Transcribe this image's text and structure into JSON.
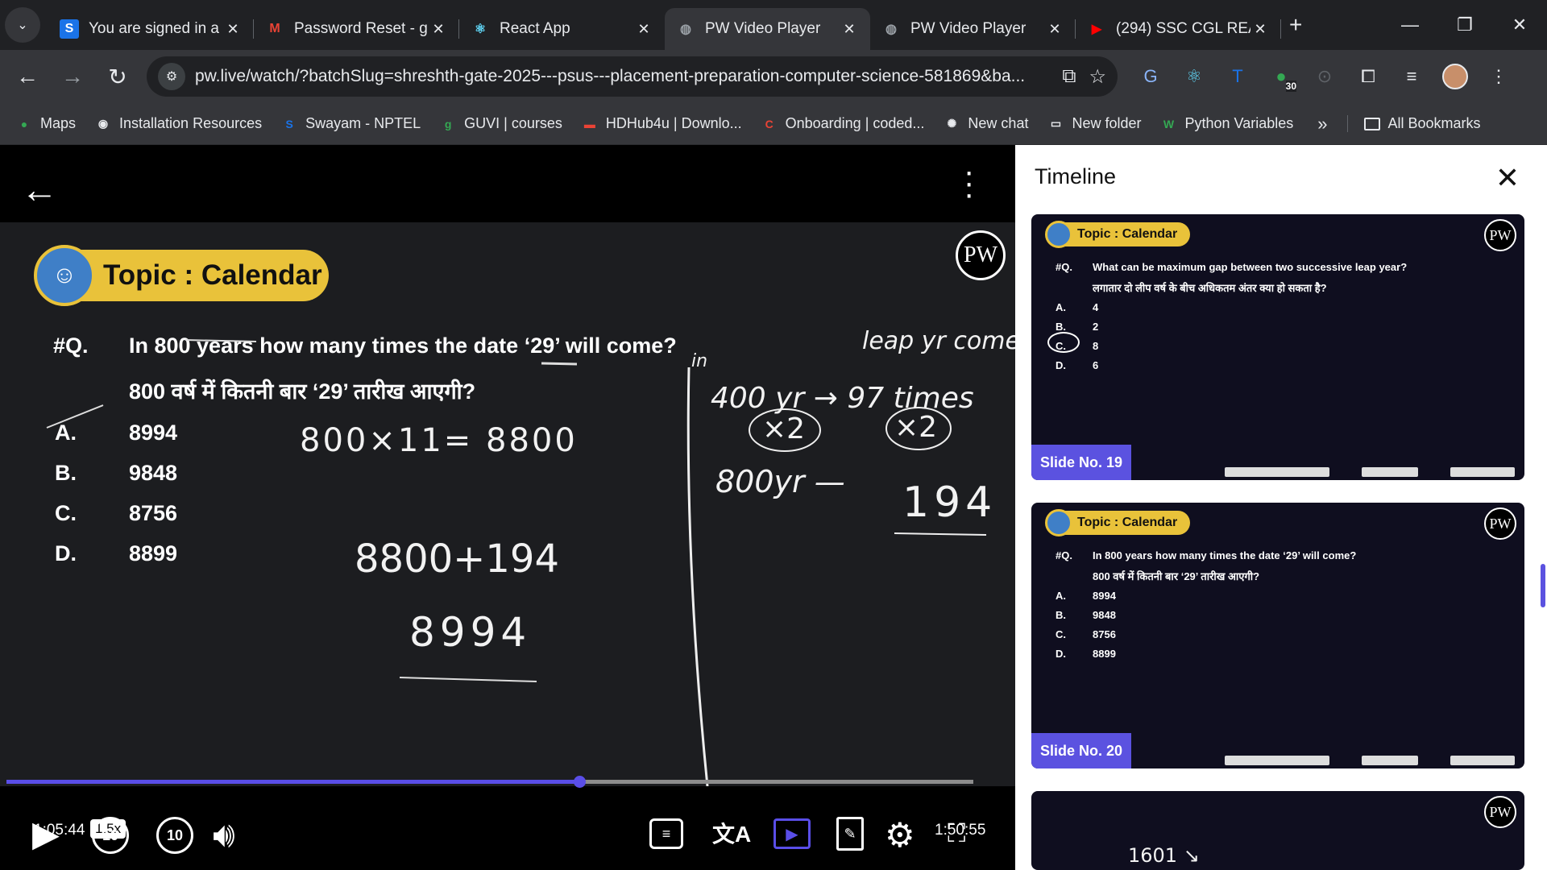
{
  "tabs": [
    {
      "title": "You are signed in a",
      "favicon": "S",
      "color": "#1a73e8"
    },
    {
      "title": "Password Reset - g",
      "favicon": "M",
      "color": "#ea4335"
    },
    {
      "title": "React App",
      "favicon": "⚛",
      "color": "#61dafb"
    },
    {
      "title": "PW Video Player",
      "favicon": "◍",
      "color": "#9aa0a6"
    },
    {
      "title": "PW Video Player",
      "favicon": "◍",
      "color": "#9aa0a6"
    },
    {
      "title": "(294) SSC CGL REA",
      "favicon": "▶",
      "color": "#ff0000"
    }
  ],
  "address": {
    "url": "pw.live/watch/?batchSlug=shreshth-gate-2025---psus---placement-preparation-computer-science-581869&ba..."
  },
  "extensions": {
    "badge": "30"
  },
  "bookmarks": [
    {
      "label": "Maps",
      "icon": "map-pin-icon",
      "glyph": "●",
      "color": "#34a853"
    },
    {
      "label": "Installation Resources",
      "icon": "globe-icon",
      "glyph": "◉",
      "color": "#e8eaed"
    },
    {
      "label": "Swayam - NPTEL",
      "icon": "swayam-icon",
      "glyph": "S",
      "color": "#1a73e8"
    },
    {
      "label": "GUVI | courses",
      "icon": "guvi-icon",
      "glyph": "g",
      "color": "#34a853"
    },
    {
      "label": "HDHub4u | Downlo...",
      "icon": "hdhub-icon",
      "glyph": "▬",
      "color": "#ea4335"
    },
    {
      "label": "Onboarding | coded...",
      "icon": "coded-icon",
      "glyph": "C",
      "color": "#ea4335"
    },
    {
      "label": "New chat",
      "icon": "chatgpt-icon",
      "glyph": "✺",
      "color": "#e8eaed"
    },
    {
      "label": "New folder",
      "icon": "folder-icon",
      "glyph": "▭",
      "color": "#e8eaed"
    },
    {
      "label": "Python Variables",
      "icon": "w3-icon",
      "glyph": "W",
      "color": "#34a853"
    }
  ],
  "bookmarks_more": "»",
  "all_bookmarks": "All Bookmarks",
  "player": {
    "topic": "Topic : Calendar",
    "logo": "PW",
    "q_marker": "#Q.",
    "question_en": "In 800 years how many times the date ‘29’ will come?",
    "question_hi": "800 वर्ष में कितनी बार ‘29’ तारीख आएगी?",
    "options": [
      {
        "letter": "A.",
        "value": "8994"
      },
      {
        "letter": "B.",
        "value": "9848"
      },
      {
        "letter": "C.",
        "value": "8756"
      },
      {
        "letter": "D.",
        "value": "8899"
      }
    ],
    "chalk": {
      "mult": "800×11= 8800",
      "sum": "8800+194",
      "answer": "8994",
      "note_top": "leap yr comes",
      "note_in": "in",
      "rule": "400 yr → 97 times",
      "x2a": "×2",
      "x2b": "×2",
      "result_left": "800yr —",
      "result_right": "194"
    },
    "current_time": "1:05:44",
    "speed": "1.5x",
    "duration": "1:50:55",
    "progress_fraction": 0.5926
  },
  "timeline": {
    "title": "Timeline",
    "slides": [
      {
        "topic": "Topic : Calendar",
        "q": "#Q.",
        "question_en": "What can be maximum gap between two successive leap year?",
        "question_hi": "लगातार दो लीप वर्ष के बीच अधिकतम अंतर क्या हो सकता है?",
        "options": [
          [
            "A.",
            "4"
          ],
          [
            "B.",
            "2"
          ],
          [
            "C.",
            "8"
          ],
          [
            "D.",
            "6"
          ]
        ],
        "label": "Slide No. 19"
      },
      {
        "topic": "Topic : Calendar",
        "q": "#Q.",
        "question_en": "In 800 years how many times the date ‘29’ will come?",
        "question_hi": "800 वर्ष में कितनी बार ‘29’ तारीख आएगी?",
        "options": [
          [
            "A.",
            "8994"
          ],
          [
            "B.",
            "9848"
          ],
          [
            "C.",
            "8756"
          ],
          [
            "D.",
            "8899"
          ]
        ],
        "label": "Slide No. 20"
      },
      {
        "chalk": "1601 ↘"
      }
    ]
  }
}
